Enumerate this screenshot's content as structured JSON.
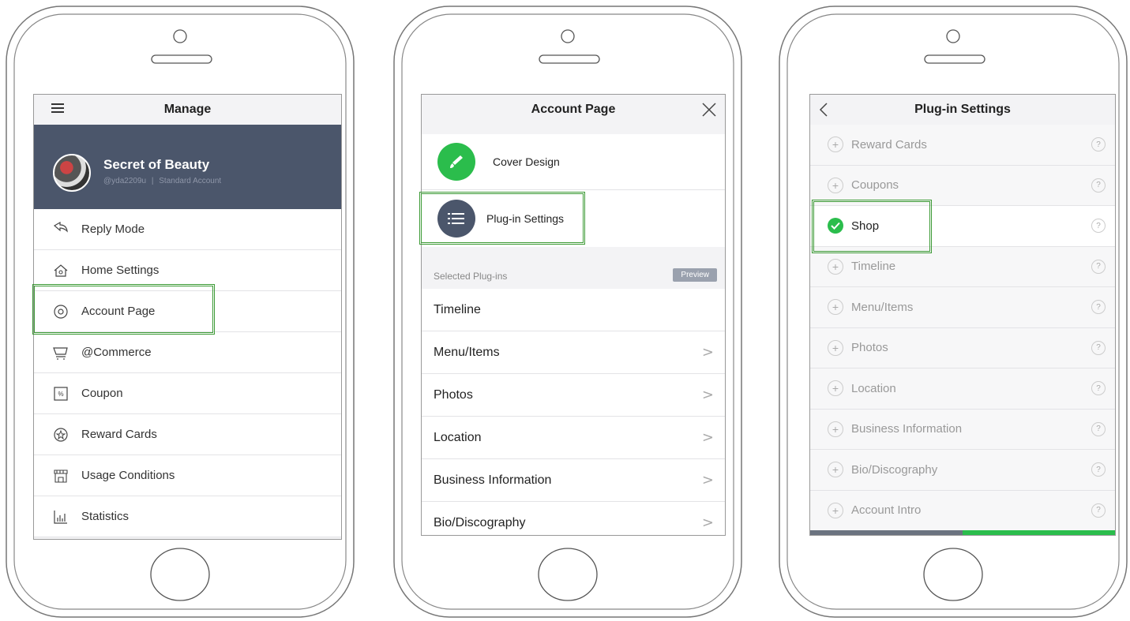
{
  "phone1": {
    "header_title": "Manage",
    "profile": {
      "name": "Secret of Beauty",
      "handle": "@yda2209u",
      "separator": "|",
      "account_type": "Standard Account"
    },
    "menu": [
      {
        "label": "Reply Mode",
        "icon": "reply-icon"
      },
      {
        "label": "Home Settings",
        "icon": "home-icon"
      },
      {
        "label": "Account Page",
        "icon": "at-icon"
      },
      {
        "label": "@Commerce",
        "icon": "cart-icon"
      },
      {
        "label": "Coupon",
        "icon": "coupon-icon"
      },
      {
        "label": "Reward Cards",
        "icon": "star-icon"
      },
      {
        "label": "Usage Conditions",
        "icon": "shop-icon"
      },
      {
        "label": "Statistics",
        "icon": "chart-icon"
      }
    ],
    "header_bg": "#4b566b"
  },
  "phone2": {
    "header_title": "Account Page",
    "cover_design": "Cover Design",
    "plugin_settings": "Plug-in Settings",
    "section_label": "Selected Plug-ins",
    "preview_button": "Preview",
    "plugins": [
      "Timeline",
      "Menu/Items",
      "Photos",
      "Location",
      "Business Information",
      "Bio/Discography"
    ],
    "chevron": ">",
    "green": "#2bbd4c",
    "navy": "#4b566b"
  },
  "phone3": {
    "header_title": "Plug-in Settings",
    "items": [
      "Reward Cards",
      "Coupons",
      "Shop",
      "Timeline",
      "Menu/Items",
      "Photos",
      "Location",
      "Business Information",
      "Bio/Discography",
      "Account Intro"
    ],
    "selected": "Shop",
    "help": "?",
    "plus": "+",
    "green": "#2bbd4c"
  }
}
